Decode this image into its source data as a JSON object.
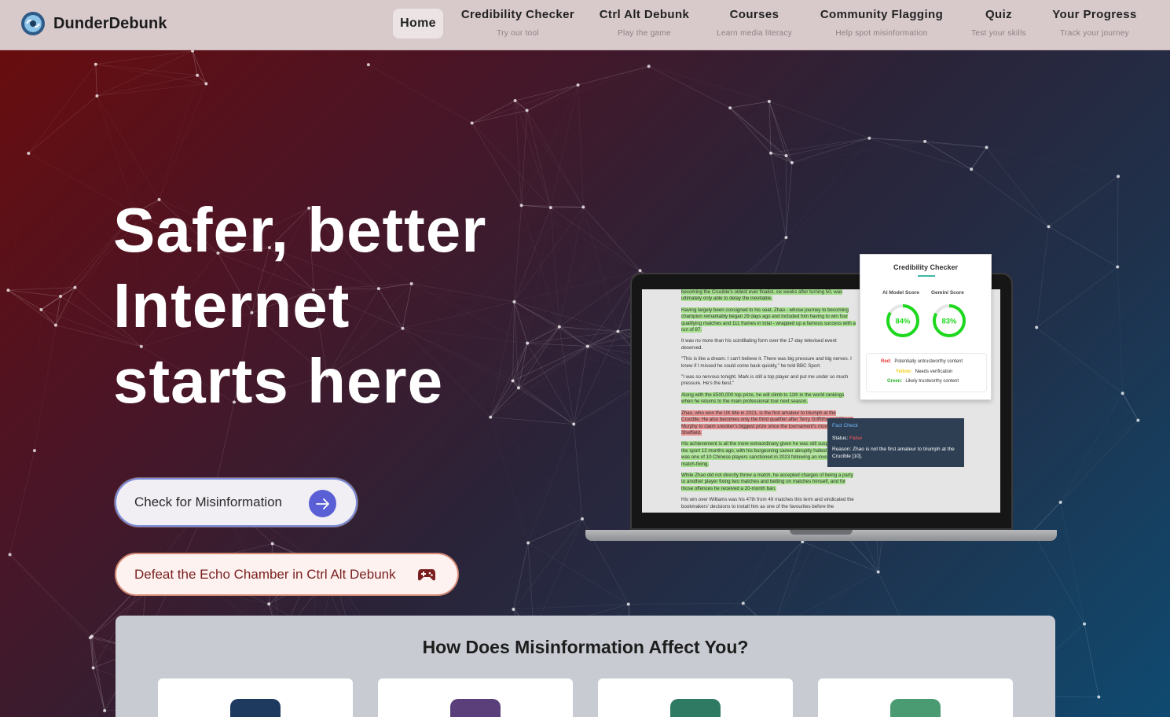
{
  "brand": {
    "name": "DunderDebunk",
    "logo_icon": "brain-gear-logo-icon"
  },
  "nav": {
    "home": "Home",
    "items": [
      {
        "label": "Credibility Checker",
        "sub": "Try our tool"
      },
      {
        "label": "Ctrl Alt Debunk",
        "sub": "Play the game"
      },
      {
        "label": "Courses",
        "sub": "Learn media literacy"
      },
      {
        "label": "Community Flagging",
        "sub": "Help spot misinformation"
      },
      {
        "label": "Quiz",
        "sub": "Test your skills"
      },
      {
        "label": "Your Progress",
        "sub": "Track your journey"
      }
    ]
  },
  "hero": {
    "headline_1": "Safer, better",
    "headline_2": "Internet",
    "headline_3": "starts here",
    "btn_check": "Check for Misinformation",
    "btn_game": "Defeat the Echo Chamber in Ctrl Alt Debunk"
  },
  "laptop": {
    "article": [
      "becoming the Crucible's oldest ever finalist, six weeks after turning 50, was ultimately only able to delay the inevitable.",
      "Having largely been consigned to his seat, Zhao - whose journey to becoming champion remarkably began 29 days ago and included him having to win four qualifying matches and 111 frames in total - wrapped up a famous success with a run of 87.",
      "It was no more than his scintillating form over the 17-day televised event deserved.",
      "\"This is like a dream. I can't believe it. There was big pressure and big nerves. I knew if I missed he could come back quickly,\" he told BBC Sport.",
      "\"I was so nervous tonight. Mark is still a top player and put me under so much pressure. He's the best.\"",
      "Along with the £500,000 top prize, he will climb to 11th in the world rankings when he returns to the main professional tour next season.",
      "Zhao, who won the UK title in 2021, is the first amateur to triumph at the Crucible. He also becomes only the third qualifier after Terry Griffiths and Shaun Murphy to claim snooker's biggest prize since the tournament's move to Sheffield.",
      "His achievement is all the more extraordinary given he was still suspended from the sport 12 months ago, with his burgeoning career abruptly halted when he was one of 10 Chinese players sanctioned in 2023 following an investigation into match-fixing.",
      "While Zhao did not directly throw a match, he accepted charges of being a party to another player fixing two matches and betting on matches himself, and for those offences he received a 20-month ban.",
      "His win over Williams was his 47th from 49 matches this term and vindicated the bookmakers' decisions to install him as one of the favourites before the"
    ],
    "panel": {
      "title": "Credibility Checker",
      "ai_label": "AI Model Score",
      "gemini_label": "Gemini Score",
      "ai_score": "84%",
      "gemini_score": "83%",
      "ai_fraction": 0.84,
      "gemini_fraction": 0.83,
      "legend": [
        {
          "key": "Red:",
          "text": "Potentially untrustworthy content",
          "color": "#e53935"
        },
        {
          "key": "Yellow:",
          "text": "Needs verification",
          "color": "#f2d21b"
        },
        {
          "key": "Green:",
          "text": "Likely trustworthy content",
          "color": "#2bb32b"
        }
      ]
    },
    "fact_check": {
      "title": "Fact Check",
      "status_label": "Status:",
      "status_value": "False",
      "reason": "Reason: Zhao is not the first amateur to triumph at the Crucible [10]."
    }
  },
  "section": {
    "title": "How Does Misinformation Affect You?",
    "card_icons": [
      {
        "name": "pencil-icon",
        "color": "#1f3a5f"
      },
      {
        "name": "chat-icon",
        "color": "#5a3f7a"
      },
      {
        "name": "person-icon",
        "color": "#2f7a63"
      },
      {
        "name": "plus-icon",
        "color": "#4a9a72"
      }
    ]
  },
  "colors": {
    "accent": "#5a5fd6",
    "game_text": "#7a1f1f",
    "gauge_green": "#1ed81e"
  }
}
